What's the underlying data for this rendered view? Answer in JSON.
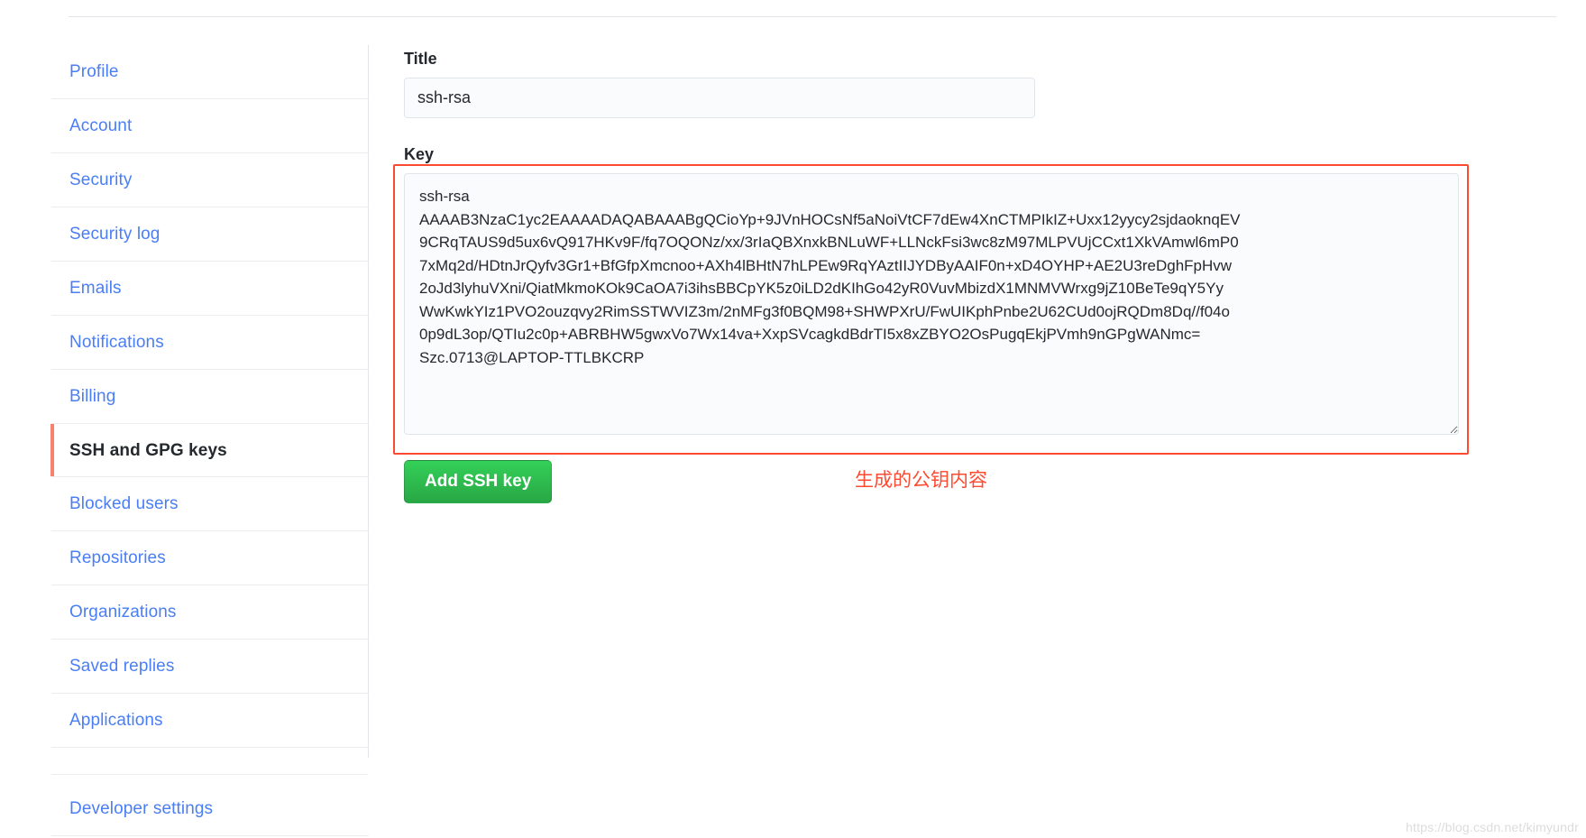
{
  "sidebar": {
    "items": [
      {
        "label": "Profile",
        "selected": false
      },
      {
        "label": "Account",
        "selected": false
      },
      {
        "label": "Security",
        "selected": false
      },
      {
        "label": "Security log",
        "selected": false
      },
      {
        "label": "Emails",
        "selected": false
      },
      {
        "label": "Notifications",
        "selected": false
      },
      {
        "label": "Billing",
        "selected": false
      },
      {
        "label": "SSH and GPG keys",
        "selected": true
      },
      {
        "label": "Blocked users",
        "selected": false
      },
      {
        "label": "Repositories",
        "selected": false
      },
      {
        "label": "Organizations",
        "selected": false
      },
      {
        "label": "Saved replies",
        "selected": false
      },
      {
        "label": "Applications",
        "selected": false
      }
    ],
    "developer": {
      "label": "Developer settings"
    }
  },
  "form": {
    "title_label": "Title",
    "title_value": "ssh-rsa",
    "title_placeholder": "",
    "key_label": "Key",
    "key_value": "ssh-rsa\nAAAAB3NzaC1yc2EAAAADAQABAAABgQCioYp+9JVnHOCsNf5aNoiVtCF7dEw4XnCTMPIkIZ+Uxx12yycy2sjdaoknqEV\n9CRqTAUS9d5ux6vQ917HKv9F/fq7OQONz/xx/3rIaQBXnxkBNLuWF+LLNckFsi3wc8zM97MLPVUjCCxt1XkVAmwl6mP0\n7xMq2d/HDtnJrQyfv3Gr1+BfGfpXmcnoo+AXh4lBHtN7hLPEw9RqYAztIIJYDByAAIF0n+xD4OYHP+AE2U3reDghFpHvw\n2oJd3lyhuVXni/QiatMkmoKOk9CaOA7i3ihsBBCpYK5z0iLD2dKIhGo42yR0VuvMbizdX1MNMVWrxg9jZ10BeTe9qY5Yy\nWwKwkYIz1PVO2ouzqvy2RimSSTWVIZ3m/2nMFg3f0BQM98+SHWPXrU/FwUIKphPnbe2U62CUd0ojRQDm8Dq//f04o\n0p9dL3op/QTIu2c0p+ABRBHW5gwxVo7Wx14va+XxpSVcagkdBdrTI5x8xZBYO2OsPugqEkjPVmh9nGPgWANmc=\nSzc.0713@LAPTOP-TTLBKCRP",
    "key_placeholder": "",
    "submit_label": "Add SSH key"
  },
  "annotation": {
    "caption": "生成的公钥内容",
    "color": "#fc4b32"
  },
  "watermark": {
    "text": "https://blog.csdn.net/kimyundr"
  }
}
